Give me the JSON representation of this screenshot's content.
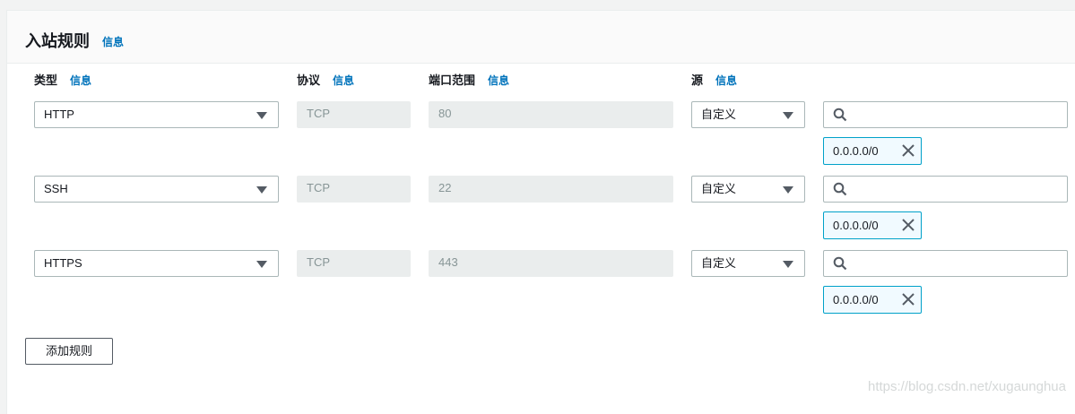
{
  "section": {
    "title": "入站规则",
    "info": "信息"
  },
  "columns": [
    {
      "label": "类型",
      "info": "信息"
    },
    {
      "label": "协议",
      "info": "信息"
    },
    {
      "label": "端口范围",
      "info": "信息"
    },
    {
      "label": "源",
      "info": "信息"
    }
  ],
  "rules": [
    {
      "type": "HTTP",
      "protocol": "TCP",
      "port": "80",
      "source_type": "自定义",
      "cidr": "0.0.0.0/0"
    },
    {
      "type": "SSH",
      "protocol": "TCP",
      "port": "22",
      "source_type": "自定义",
      "cidr": "0.0.0.0/0"
    },
    {
      "type": "HTTPS",
      "protocol": "TCP",
      "port": "443",
      "source_type": "自定义",
      "cidr": "0.0.0.0/0"
    }
  ],
  "add_rule_label": "添加规则",
  "watermark": "https://blog.csdn.net/xugaunghua"
}
